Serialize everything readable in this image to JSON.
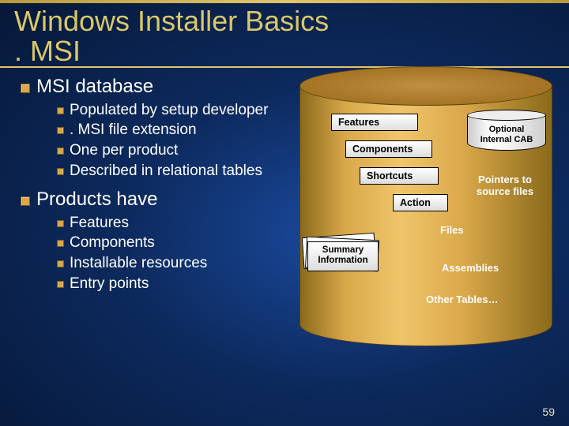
{
  "title_line1": "Windows Installer Basics",
  "title_line2": ". MSI",
  "bullets": {
    "h1": "MSI database",
    "h1_items": [
      "Populated by setup developer",
      ". MSI file extension",
      "One per product",
      "Described in relational tables"
    ],
    "h2": "Products have",
    "h2_items": [
      "Features",
      "Components",
      "Installable resources",
      "Entry points"
    ]
  },
  "diagram": {
    "features": "Features",
    "components": "Components",
    "shortcuts": "Shortcuts",
    "action": "Action",
    "summary_l1": "Summary",
    "summary_l2": "Information",
    "optional_l1": "Optional",
    "optional_l2": "Internal CAB",
    "pointers_l1": "Pointers to",
    "pointers_l2": "source files",
    "files": "Files",
    "assemblies": "Assemblies",
    "other": "Other Tables…"
  },
  "slide_number": "59"
}
